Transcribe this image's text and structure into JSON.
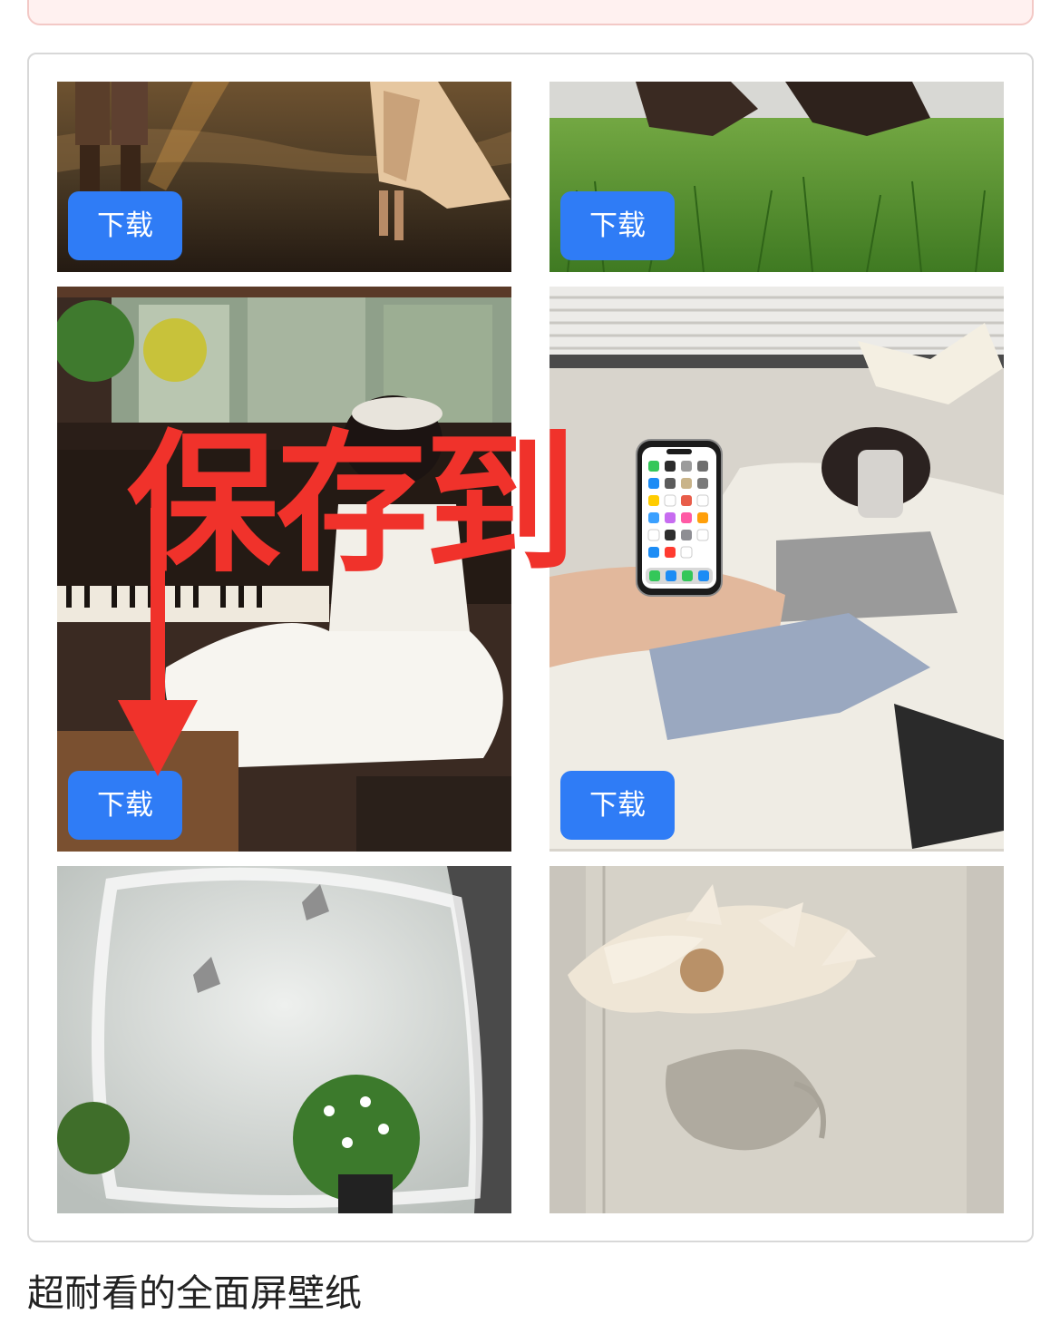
{
  "gallery": {
    "download_label": "下载",
    "items": [
      {
        "name": "beach-sunset-photo",
        "has_download": true
      },
      {
        "name": "grass-photo",
        "has_download": true
      },
      {
        "name": "piano-girl-photo",
        "has_download": true
      },
      {
        "name": "sofa-girl-photo",
        "has_download": true
      },
      {
        "name": "butterfly-window-photo",
        "has_download": false
      },
      {
        "name": "paper-flower-photo",
        "has_download": false
      }
    ]
  },
  "overlay": {
    "text": "保存到",
    "icon": "iphone-icon",
    "arrow_color": "#f0322b"
  },
  "caption": "超耐看的全面屏壁纸",
  "colors": {
    "download_button": "#2f7cf6",
    "overlay_red": "#f0322b",
    "banner_border": "#f3c9c6"
  }
}
